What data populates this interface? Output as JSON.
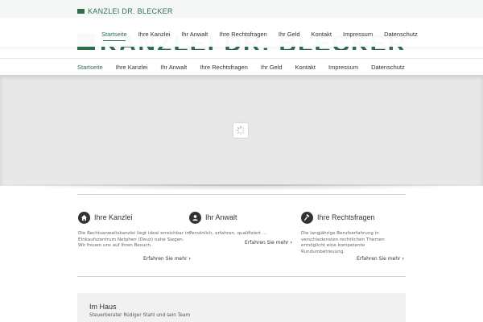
{
  "header": {
    "logo_text": "KANZLEI DR. BLECKER"
  },
  "nav": {
    "items": [
      {
        "label": "Startseite"
      },
      {
        "label": "Ihre Kanzlei"
      },
      {
        "label": "Ihr Anwalt"
      },
      {
        "label": "Ihre Rechtsfragen"
      },
      {
        "label": "Ihr Geld"
      },
      {
        "label": "Kontakt"
      },
      {
        "label": "Impressum"
      },
      {
        "label": "Datenschutz"
      }
    ],
    "active_index": 0
  },
  "features": [
    {
      "icon": "home-icon",
      "title": "Ihre Kanzlei",
      "text": "Die Rechtsanwaltskanzlei liegt ideal erreichbar im Einkaufszentrum Netphen (Deuz) nahe Siegen. Wir freuen uns auf Ihren Besuch.",
      "more": "Erfahren Sie mehr"
    },
    {
      "icon": "user-icon",
      "title": "Ihr Anwalt",
      "text": "Persönlich, erfahren, qualifiziert ...",
      "more": "Erfahren Sie mehr"
    },
    {
      "icon": "gavel-icon",
      "title": "Ihre Rechtsfragen",
      "text": "Die langjährige Berufserfahrung in verschiedensten rechtlichen Themen ermöglicht eine kompetente Rundumbetreuung.",
      "more": "Erfahren Sie mehr"
    }
  ],
  "haus": {
    "title": "Im Haus",
    "text": "Steuerberater Rüdiger Stahl und sein Team"
  },
  "colors": {
    "brand": "#2e6e4e",
    "slider_bg": "#e8e8e8"
  }
}
